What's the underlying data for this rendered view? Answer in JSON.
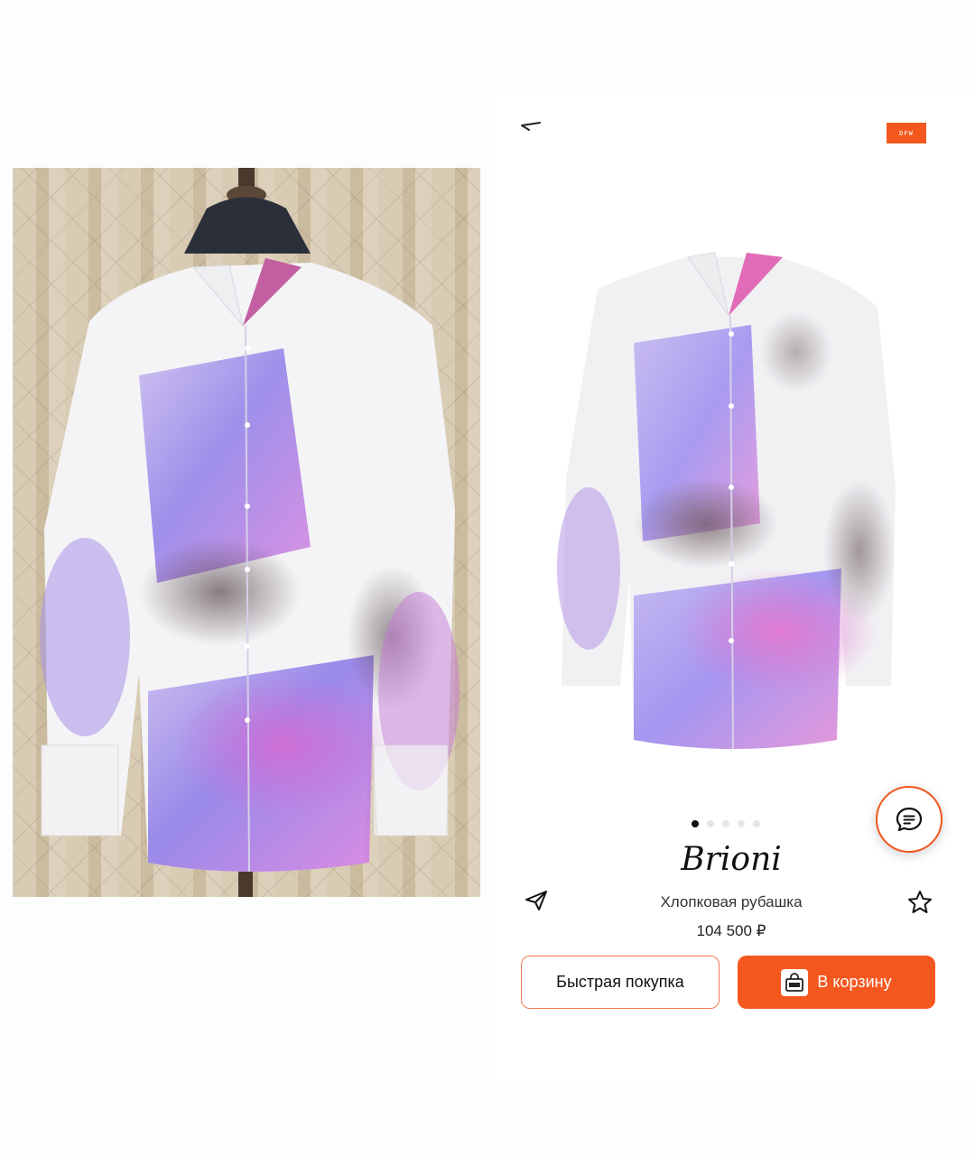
{
  "header": {
    "back_icon": "back-arrow-icon",
    "brand_badge_text": "DFW"
  },
  "product": {
    "brand": "Brioni",
    "name": "Хлопковая рубашка",
    "price": "104 500 ₽",
    "gallery_dots": 5,
    "active_dot": 1
  },
  "actions": {
    "quick_buy": "Быстрая покупка",
    "add_to_cart": "В корзину",
    "share_icon": "paper-plane-icon",
    "favorite_icon": "star-outline-icon",
    "chat_icon": "chat-bubble-icon"
  },
  "colors": {
    "accent": "#f4581f",
    "text": "#222222"
  }
}
